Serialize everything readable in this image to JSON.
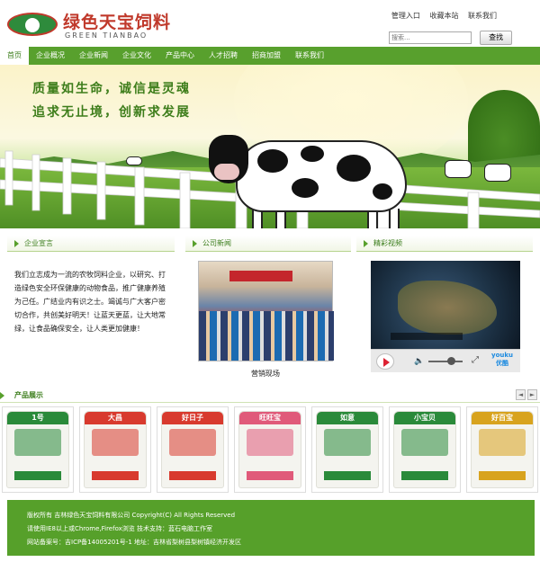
{
  "header": {
    "logo_cn": "绿色天宝饲料",
    "logo_en": "GREEN TIANBAO",
    "links": [
      "管理入口",
      "收藏本站",
      "联系我们"
    ],
    "search_placeholder": "搜索...",
    "search_button": "查找"
  },
  "nav": {
    "items": [
      "首页",
      "企业概况",
      "企业新闻",
      "企业文化",
      "产品中心",
      "人才招聘",
      "招商加盟",
      "联系我们"
    ]
  },
  "banner": {
    "slogan1": "质量如生命，诚信是灵魂",
    "slogan2": "追求无止境，创新求发展"
  },
  "about": {
    "title": "企业宣言",
    "text": "我们立志成为一流的农牧饲料企业，以研究、打造绿色安全环保健康的动物食品，推广健康养殖为己任。广结业内有识之士。竭诚与广大客户密切合作，共创美好明天！让蓝天更蓝，让大地常绿，让食品确保安全，让人类更加健康！"
  },
  "news": {
    "title": "公司新闻",
    "caption": "营销现场"
  },
  "video": {
    "title": "精彩视频",
    "brand_top": "youku",
    "brand_bottom": "优酷",
    "volume_level": 0.65
  },
  "products": {
    "title": "产品展示",
    "prev": "◄",
    "next": "►",
    "items": [
      {
        "label": "1号",
        "color": "#2a8a3a"
      },
      {
        "label": "大昌",
        "color": "#d83a2e"
      },
      {
        "label": "好日子",
        "color": "#d83a2e"
      },
      {
        "label": "旺旺宝",
        "color": "#e05a7a"
      },
      {
        "label": "如意",
        "color": "#2a8a3a"
      },
      {
        "label": "小宝贝",
        "color": "#2a8a3a"
      },
      {
        "label": "好百宝",
        "color": "#d8a31e"
      }
    ]
  },
  "footer": {
    "line1": "版权所有 吉林绿色天宝饲料有限公司 Copyright(C) All Rights Reserved",
    "line2": "请使用IE8以上或Chrome,Firefox浏览 技术支持：蓝石电脑工作室",
    "line3": "网站备案号：吉ICP备14005201号-1 地址：吉林省梨树县梨树镇经济开发区"
  },
  "colors": {
    "brand_green": "#58a02d",
    "logo_red": "#c0392b"
  }
}
